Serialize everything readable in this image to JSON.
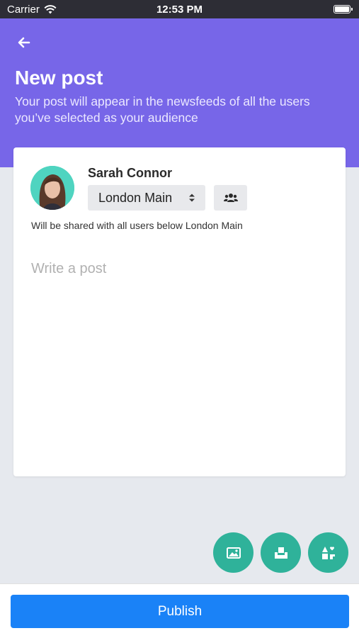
{
  "status_bar": {
    "carrier": "Carrier",
    "time": "12:53 PM"
  },
  "header": {
    "title": "New post",
    "subtitle": "Your post will appear in the newsfeeds of all the users you’ve selected as your audience",
    "background_color": "#7766e8"
  },
  "composer": {
    "author_name": "Sarah Connor",
    "audience_selected": "London Main",
    "shared_note": "Will be shared with all users below London Main",
    "post_placeholder": "Write a post",
    "post_value": ""
  },
  "actions": {
    "icons": [
      "image-icon",
      "inbox-icon",
      "media-icon"
    ],
    "accent_color": "#2fb29a"
  },
  "footer": {
    "publish_label": "Publish",
    "button_color": "#1a82f7"
  }
}
